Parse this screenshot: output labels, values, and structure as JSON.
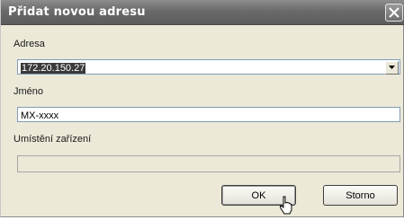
{
  "dialog": {
    "title": "Přidat novou adresu",
    "close_icon": "close-icon"
  },
  "form": {
    "address_label": "Adresa",
    "address_value": "172.20.150.27",
    "name_label": "Jméno",
    "name_value": "MX-xxxx",
    "location_label": "Umístění zařízení",
    "location_value": ""
  },
  "buttons": {
    "ok_label": "OK",
    "cancel_label": "Storno"
  },
  "colors": {
    "titlebar": "#6a6a6a",
    "dialog_background": "#ece9d8"
  }
}
